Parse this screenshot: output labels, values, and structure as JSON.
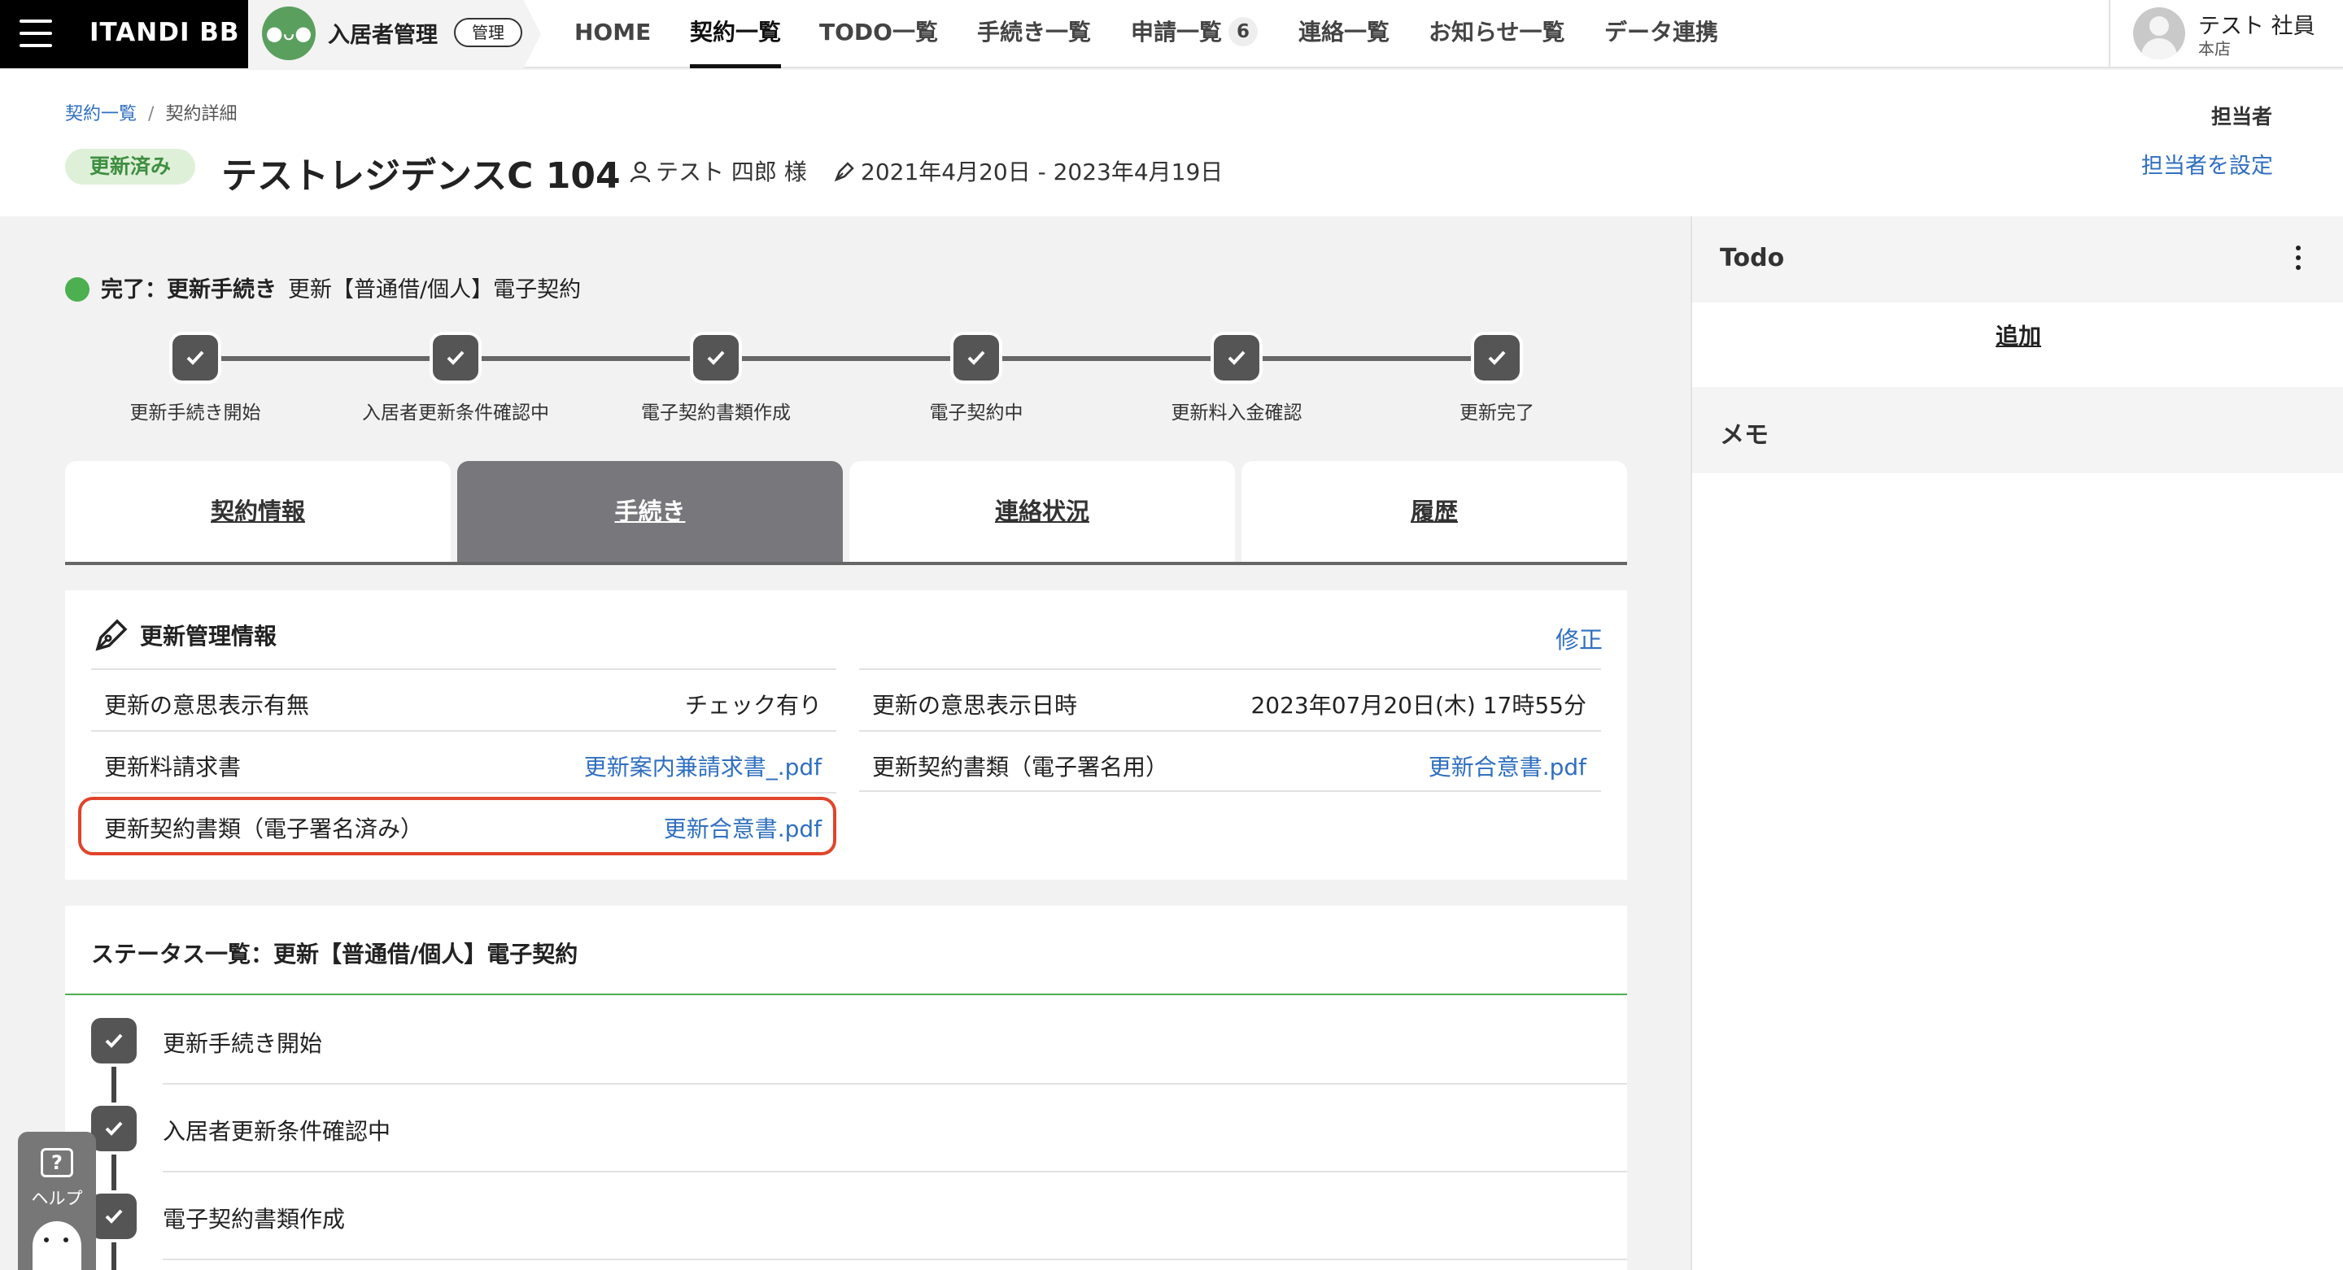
{
  "topbar": {
    "brand": "ITANDI BB",
    "app_name": "入居者管理",
    "app_badge": "管理",
    "nav": [
      {
        "label": "HOME"
      },
      {
        "label": "契約一覧"
      },
      {
        "label": "TODO一覧"
      },
      {
        "label": "手続き一覧"
      },
      {
        "label": "申請一覧",
        "count": "6"
      },
      {
        "label": "連絡一覧"
      },
      {
        "label": "お知らせ一覧"
      },
      {
        "label": "データ連携"
      }
    ],
    "active_nav": "契約一覧",
    "user": {
      "name": "テスト 社員",
      "branch": "本店"
    }
  },
  "header": {
    "breadcrumb": [
      "契約一覧",
      "契約詳細"
    ],
    "status": "更新済み",
    "property": "テストレジデンスC 104",
    "tenant": "テスト 四郎 様",
    "period": "2021年4月20日 - 2023年4月19日",
    "owner_title": "担当者",
    "owner_link": "担当者を設定"
  },
  "progress": {
    "status_label": "完了：更新手続き",
    "procedure": "更新【普通借/個人】電子契約",
    "steps": [
      "更新手続き開始",
      "入居者更新条件確認中",
      "電子契約書類作成",
      "電子契約中",
      "更新料入金確認",
      "更新完了"
    ]
  },
  "tabs": [
    {
      "label": "契約情報"
    },
    {
      "label": "手続き"
    },
    {
      "label": "連絡状況"
    },
    {
      "label": "履歴"
    }
  ],
  "active_tab": "手続き",
  "renewal_info": {
    "title": "更新管理情報",
    "edit": "修正",
    "left": [
      {
        "label": "更新の意思表示有無",
        "value": "チェック有り"
      },
      {
        "label": "更新料請求書",
        "value": "更新案内兼請求書_.pdf"
      },
      {
        "label": "更新契約書類（電子署名済み）",
        "value": "更新合意書.pdf"
      }
    ],
    "right": [
      {
        "label": "更新の意思表示日時",
        "value": "2023年07月20日(木) 17時55分"
      },
      {
        "label": "更新契約書類（電子署名用）",
        "value": "更新合意書.pdf"
      }
    ]
  },
  "status_list": {
    "title": "ステータス一覧：更新【普通借/個人】電子契約",
    "items": [
      "更新手続き開始",
      "入居者更新条件確認中",
      "電子契約書類作成"
    ]
  },
  "help": {
    "label": "ヘルプ"
  },
  "sidebar": {
    "todo_title": "Todo",
    "add": "追加",
    "memo_title": "メモ"
  },
  "colors": {
    "accent_link": "#2f6fbf",
    "status_green": "#4caf50",
    "highlight_red": "#e0442b",
    "active_tab": "#78787c"
  }
}
